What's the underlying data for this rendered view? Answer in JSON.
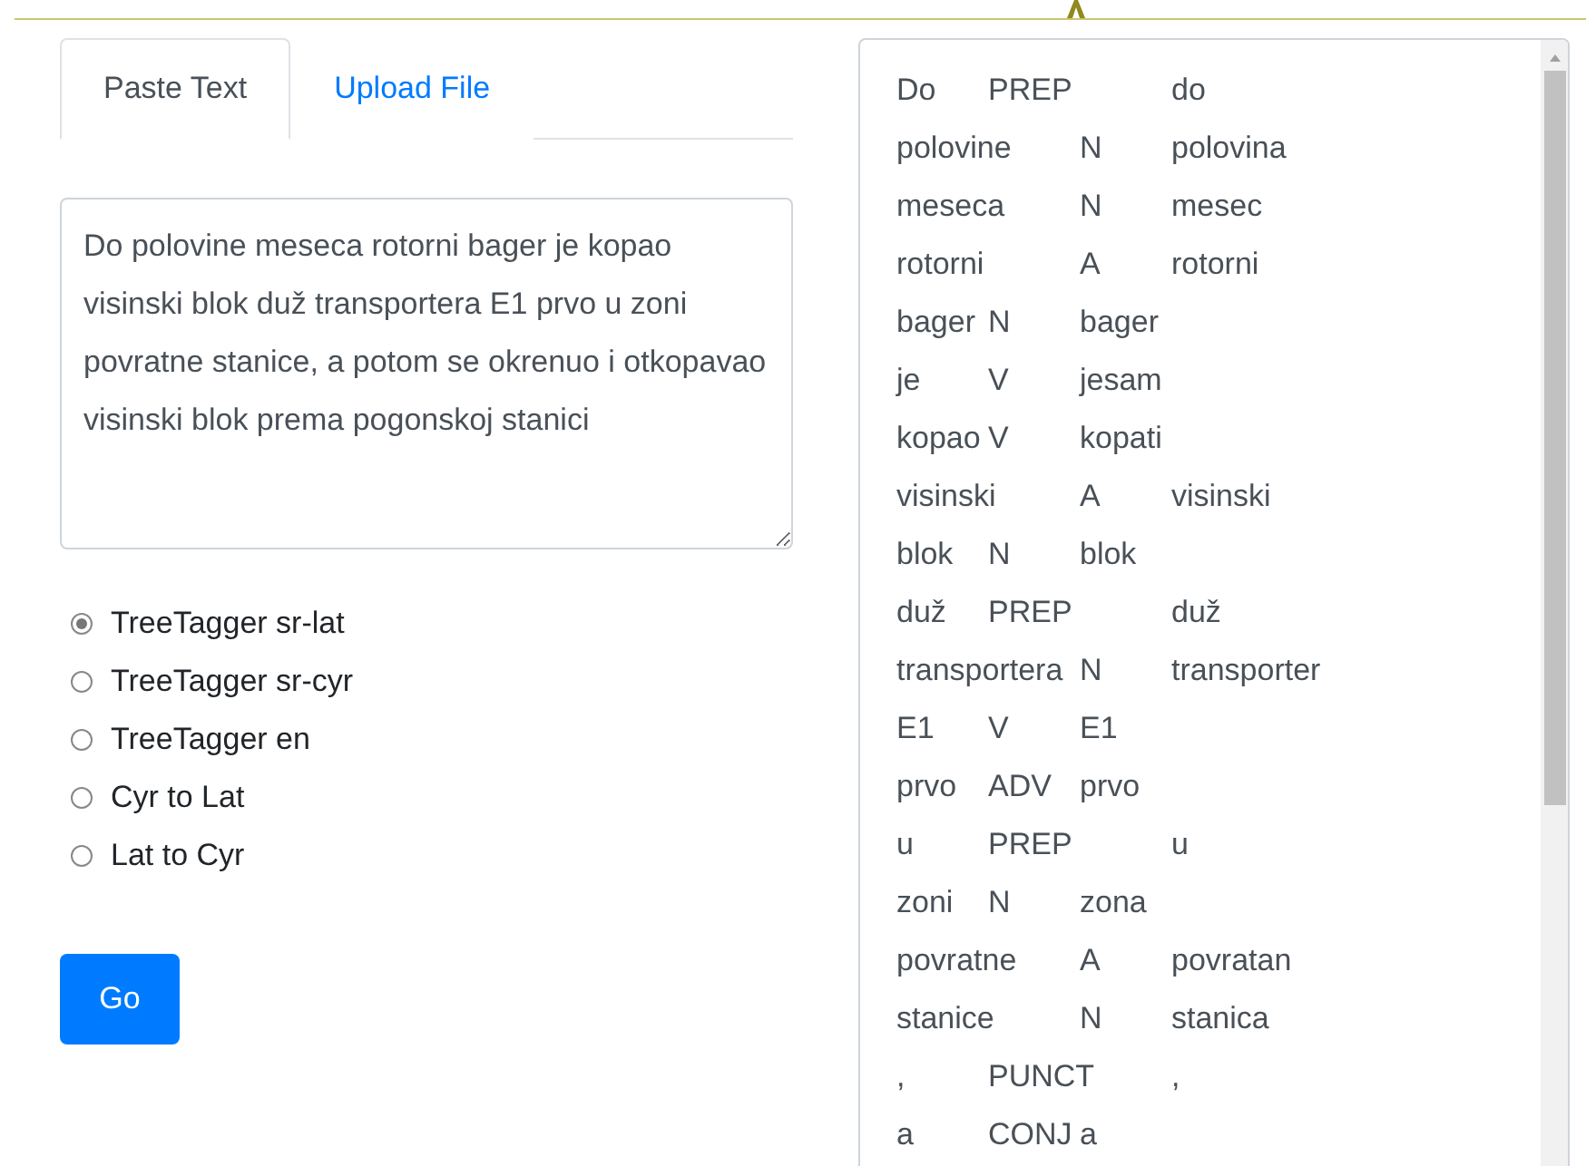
{
  "tabs": [
    {
      "label": "Paste Text",
      "selected": true
    },
    {
      "label": "Upload File",
      "selected": false
    }
  ],
  "input_text": {
    "value": "Do polovine meseca rotorni bager je kopao visinski blok duž transportera E1 prvo u zoni povratne stanice, a potom se okrenuo i otkopavao visinski blok prema pogonskoj stanici"
  },
  "options": [
    {
      "label": "TreeTagger sr-lat",
      "selected": true
    },
    {
      "label": "TreeTagger sr-cyr",
      "selected": false
    },
    {
      "label": "TreeTagger en",
      "selected": false
    },
    {
      "label": "Cyr to Lat",
      "selected": false
    },
    {
      "label": "Lat to Cyr",
      "selected": false
    }
  ],
  "go_button": "Go",
  "output_lines": [
    "Do\tPREP\t\tdo",
    "polovine\tN\tpolovina",
    "meseca\tN\tmesec",
    "rotorni\tA\trotorni",
    "bager\tN\tbager",
    "je\tV\tjesam",
    "kopao\tV\tkopati",
    "visinski\tA\tvisinski",
    "blok\tN\tblok",
    "duž\tPREP\t\tduž",
    "transportera\tN\ttransporter",
    "E1\tV\tE1",
    "prvo\tADV\tprvo",
    "u\tPREP\t\tu",
    "zoni\tN\tzona",
    "povratne\tA\tpovratan",
    "stanice\tN\tstanica",
    ",\tPUNCT\t,",
    "a\tCONJ\ta"
  ]
}
